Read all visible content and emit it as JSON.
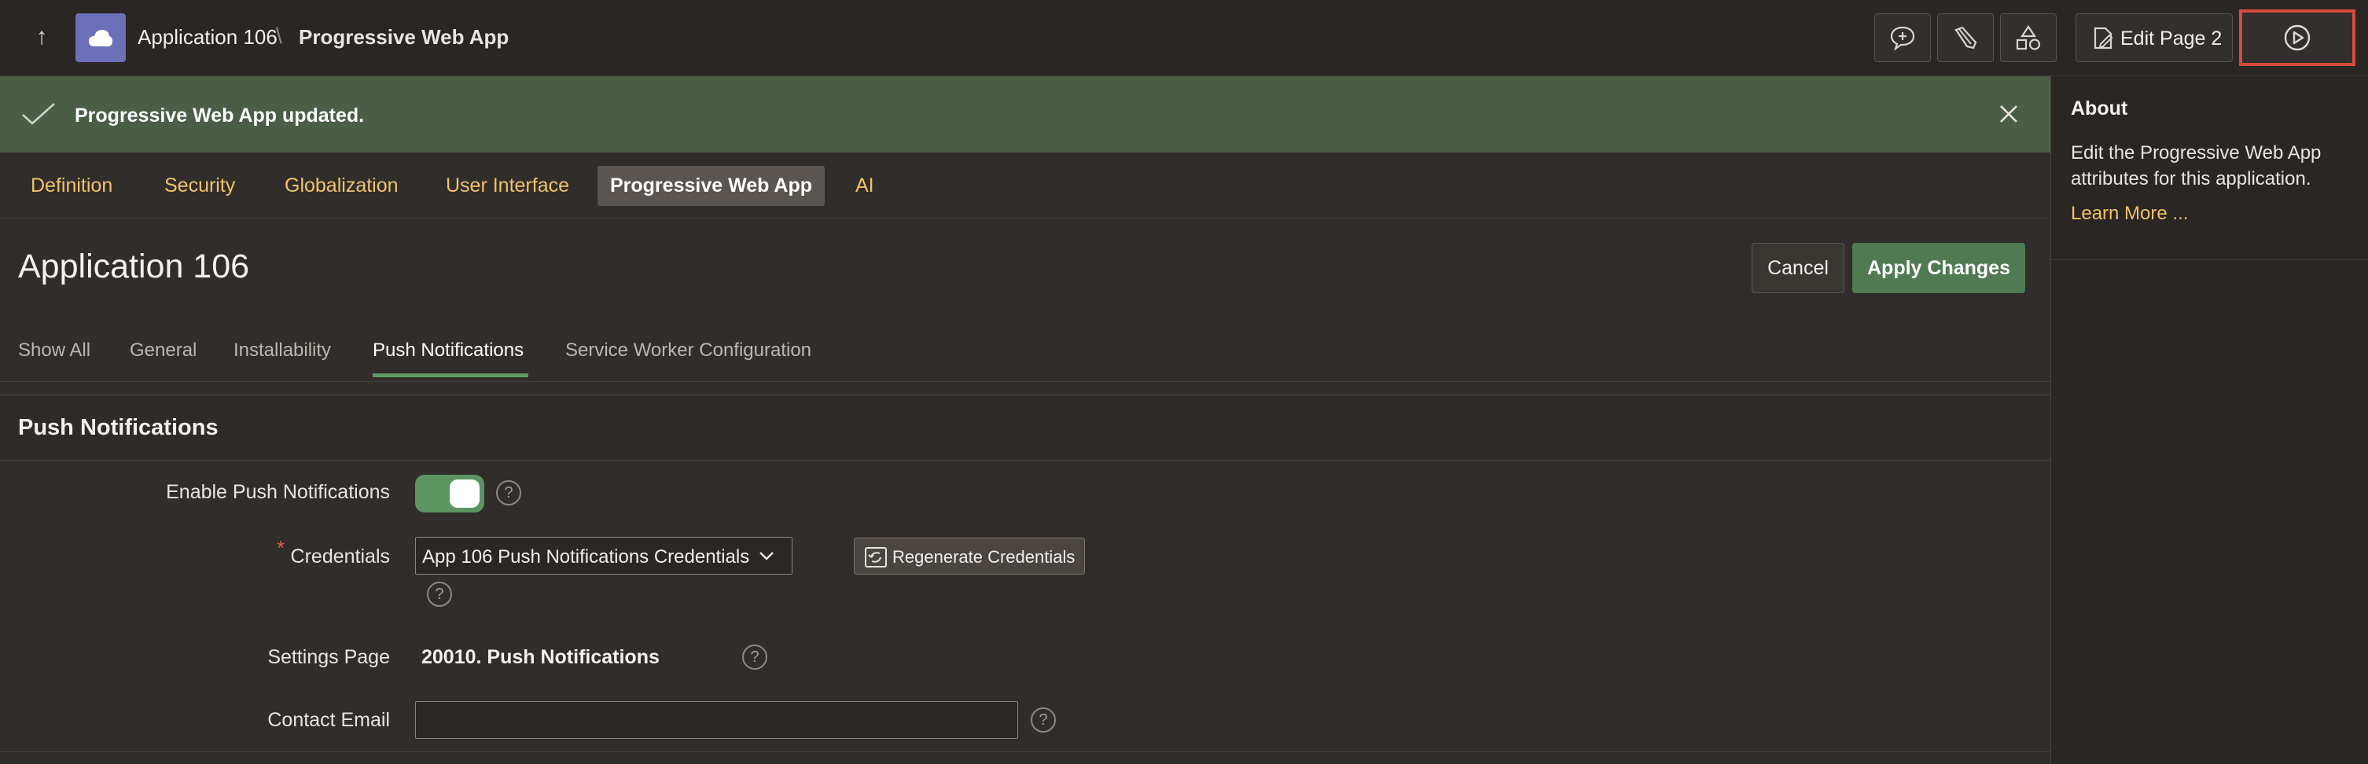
{
  "header": {
    "breadcrumb_app": "Application 106",
    "breadcrumb_separator": "\\",
    "breadcrumb_page": "Progressive Web App",
    "edit_page_label": "Edit Page 2"
  },
  "banner": {
    "message": "Progressive Web App updated."
  },
  "main_tabs": [
    {
      "label": "Definition"
    },
    {
      "label": "Security"
    },
    {
      "label": "Globalization"
    },
    {
      "label": "User Interface"
    },
    {
      "label": "Progressive Web App"
    },
    {
      "label": "AI"
    }
  ],
  "page": {
    "title": "Application 106",
    "cancel_label": "Cancel",
    "apply_label": "Apply Changes"
  },
  "sub_tabs": [
    {
      "label": "Show All"
    },
    {
      "label": "General"
    },
    {
      "label": "Installability"
    },
    {
      "label": "Push Notifications"
    },
    {
      "label": "Service Worker Configuration"
    }
  ],
  "region": {
    "title": "Push Notifications",
    "enable_label": "Enable Push Notifications",
    "enable_value": true,
    "credentials_label": "Credentials",
    "credentials_value": "App 106 Push Notifications Credentials",
    "regenerate_label": "Regenerate Credentials",
    "settings_page_label": "Settings Page",
    "settings_page_value": "20010. Push Notifications",
    "contact_email_label": "Contact Email",
    "contact_email_value": "",
    "help_glyph": "?",
    "required_glyph": "*"
  },
  "about": {
    "title": "About",
    "description": "Edit the Progressive Web App attributes for this application.",
    "learn_more": "Learn More ..."
  },
  "colors": {
    "accent_link": "#f0c36a",
    "success_banner": "#4a5e45",
    "primary_button": "#4f7a52",
    "highlight_border": "#d64b3d"
  }
}
